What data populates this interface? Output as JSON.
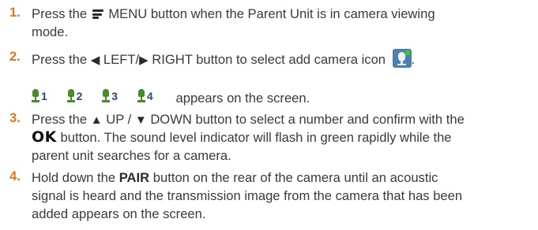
{
  "steps": [
    {
      "number": "1.",
      "line1": {
        "a": "Press the",
        "icon_name": "menu-icon",
        "b": "MENU button when the Parent Unit is in camera viewing"
      },
      "line2": "mode."
    },
    {
      "number": "2.",
      "line1": {
        "a": "Press the",
        "left_arrow": "◀",
        "b": "LEFT/",
        "right_arrow": "▶",
        "c": "RIGHT button to select add camera icon",
        "icon_name": "add-camera-icon",
        "d": "."
      }
    },
    {
      "number": "3.",
      "line1": {
        "a": "Press the",
        "up_arrow": "▲",
        "b": "UP /",
        "down_arrow": "▼",
        "c": "DOWN button to select a number and confirm with the"
      },
      "line2": {
        "ok": "OK",
        "b": "button. The sound level indicator will flash in green rapidly while the"
      },
      "line3": "parent unit searches for a camera."
    },
    {
      "number": "4.",
      "line1": {
        "a": "Hold down the",
        "pair": "PAIR",
        "b": "button on the rear of the camera until an acoustic"
      },
      "line2": "signal is heard and the transmission image from the camera that has been",
      "line3": "added appears on the screen."
    }
  ],
  "camera_numbers": {
    "numbers": [
      "1",
      "2",
      "3",
      "4"
    ],
    "icon_name": "camera-number-icon",
    "text": "appears on the screen."
  },
  "colors": {
    "step_number": "#e2761e",
    "text": "#3a3a3a",
    "icon_blue": "#4a7fae",
    "icon_green": "#39c439",
    "camera_icon_green": "#4a8a2a"
  }
}
